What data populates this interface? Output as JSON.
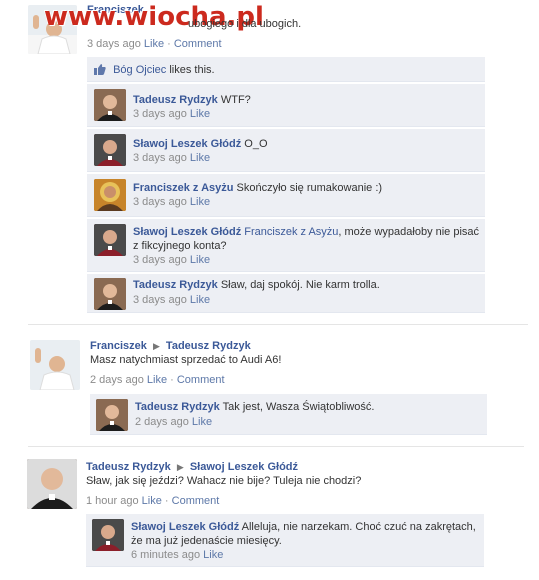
{
  "watermark": "www.wiocha.pl",
  "post1": {
    "author": "Franciszek",
    "text": "ubogiego i dla ubogich.",
    "time": "3 days ago",
    "like": "Like",
    "comment": "Comment",
    "likes_name": "Bóg Ojciec",
    "likes_text": "likes this.",
    "comments": [
      {
        "author": "Tadeusz Rydzyk",
        "text": "WTF?",
        "time": "3 days ago",
        "like": "Like"
      },
      {
        "author": "Sławoj Leszek Głódź",
        "text": "O_O",
        "time": "3 days ago",
        "like": "Like"
      },
      {
        "author": "Franciszek z Asyżu",
        "text": "Skończyło się rumakowanie :)",
        "time": "3 days ago",
        "like": "Like"
      },
      {
        "author": "Sławoj Leszek Głódź",
        "mention": "Franciszek z Asyżu",
        "text1": ", może wypadałoby nie pisać",
        "text2": "z fikcyjnego konta?",
        "time": "3 days ago",
        "like": "Like"
      },
      {
        "author": "Tadeusz Rydzyk",
        "text": "Sław, daj spokój. Nie karm trolla.",
        "time": "3 days ago",
        "like": "Like"
      }
    ]
  },
  "post2": {
    "author": "Franciszek",
    "target": "Tadeusz Rydzyk",
    "text": "Masz natychmiast sprzedać to Audi A6!",
    "time": "2 days ago",
    "like": "Like",
    "comment": "Comment",
    "comments": [
      {
        "author": "Tadeusz Rydzyk",
        "text": "Tak jest, Wasza Świątobliwość.",
        "time": "2 days ago",
        "like": "Like"
      }
    ]
  },
  "post3": {
    "author": "Tadeusz Rydzyk",
    "target": "Sławoj Leszek Głódź",
    "text": "Sław, jak się jeździ? Wahacz nie bije? Tuleja nie chodzi?",
    "time": "1 hour ago",
    "like": "Like",
    "comment": "Comment",
    "comments": [
      {
        "author": "Sławoj Leszek Głódź",
        "text1": "Alleluja, nie narzekam. Choć czuć na zakrętach,",
        "text2": "że ma już jedenaście miesięcy.",
        "time": "6 minutes ago",
        "like": "Like"
      }
    ]
  }
}
